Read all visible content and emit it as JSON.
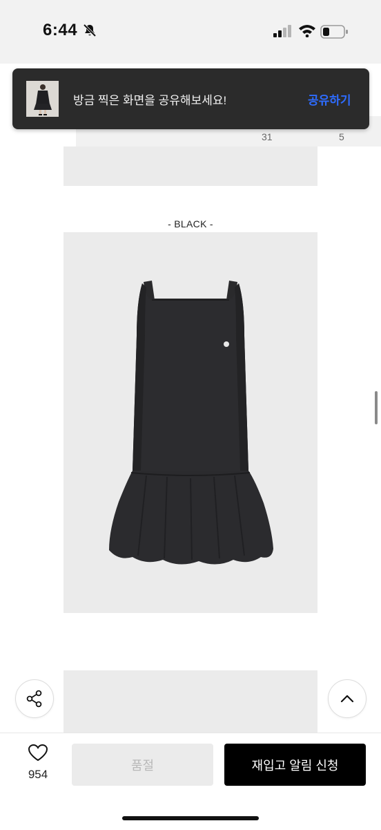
{
  "status_bar": {
    "time": "6:44"
  },
  "toast": {
    "message": "방금 찍은 화면을 공유해보세요!",
    "action_label": "공유하기"
  },
  "size_table": {
    "row_values": [
      "31",
      "5"
    ]
  },
  "product": {
    "color_label": "- BLACK -"
  },
  "bottom_bar": {
    "like_count": "954",
    "soldout_label": "품절",
    "restock_label": "재입고 알림 신청"
  },
  "colors": {
    "accent_blue": "#2e6cff",
    "toast_bg": "#2b2b2b",
    "primary_button": "#000000",
    "disabled_button": "#ebebeb"
  },
  "icons": [
    "bell-muted-icon",
    "signal-icon",
    "wifi-icon",
    "battery-icon",
    "share-icon",
    "chevron-up-icon",
    "heart-icon"
  ]
}
